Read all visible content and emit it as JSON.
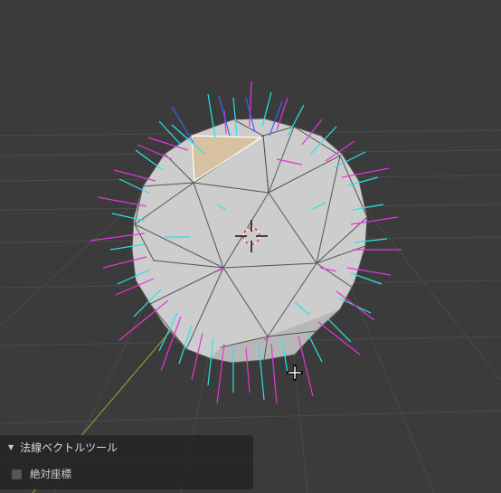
{
  "viewport": {
    "colors": {
      "background": "#3b3b3b",
      "grid": "#4a4a4a",
      "y_axis": "#8a9c34",
      "mesh": "#cdcdcd",
      "edges": "#555555",
      "selected_face": "#d7c1a0",
      "normal_cyan": "#26e6e6",
      "normal_magenta": "#e633d9",
      "normal_blue": "#3a66ff"
    },
    "icons": [
      "3d-cursor-icon",
      "move-cursor-icon"
    ]
  },
  "panel": {
    "title": "法線ベクトルツール",
    "collapse_icon": "triangle-down-icon",
    "option_label": "絶対座標",
    "option_checked": false
  }
}
